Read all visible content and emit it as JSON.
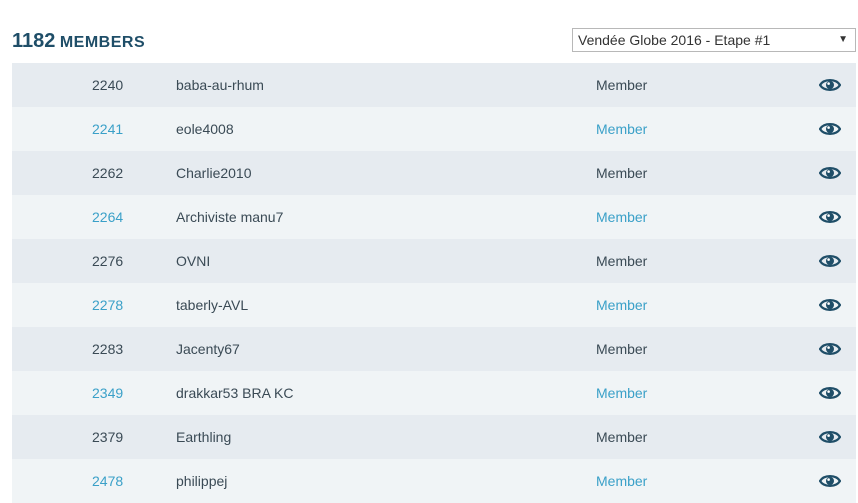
{
  "header": {
    "count": "1182",
    "label": "MEMBERS"
  },
  "race_select": {
    "selected": "Vendée Globe 2016 - Etape #1"
  },
  "members": [
    {
      "number": "2240",
      "name": "baba-au-rhum",
      "status": "Member"
    },
    {
      "number": "2241",
      "name": "eole4008",
      "status": "Member"
    },
    {
      "number": "2262",
      "name": "Charlie2010",
      "status": "Member"
    },
    {
      "number": "2264",
      "name": "Archiviste manu7",
      "status": "Member"
    },
    {
      "number": "2276",
      "name": "OVNI",
      "status": "Member"
    },
    {
      "number": "2278",
      "name": "taberly-AVL",
      "status": "Member"
    },
    {
      "number": "2283",
      "name": "Jacenty67",
      "status": "Member"
    },
    {
      "number": "2349",
      "name": "drakkar53 BRA KC",
      "status": "Member"
    },
    {
      "number": "2379",
      "name": "Earthling",
      "status": "Member"
    },
    {
      "number": "2478",
      "name": "philippej",
      "status": "Member"
    }
  ],
  "icons": {
    "view": "eye-icon",
    "dropdown": "chevron-down-icon"
  },
  "colors": {
    "title": "#1f4e68",
    "accent": "#3aa0c8",
    "row_dark": "#e6ebf0",
    "row_light": "#f0f4f6",
    "eye": "#1f4e68"
  }
}
